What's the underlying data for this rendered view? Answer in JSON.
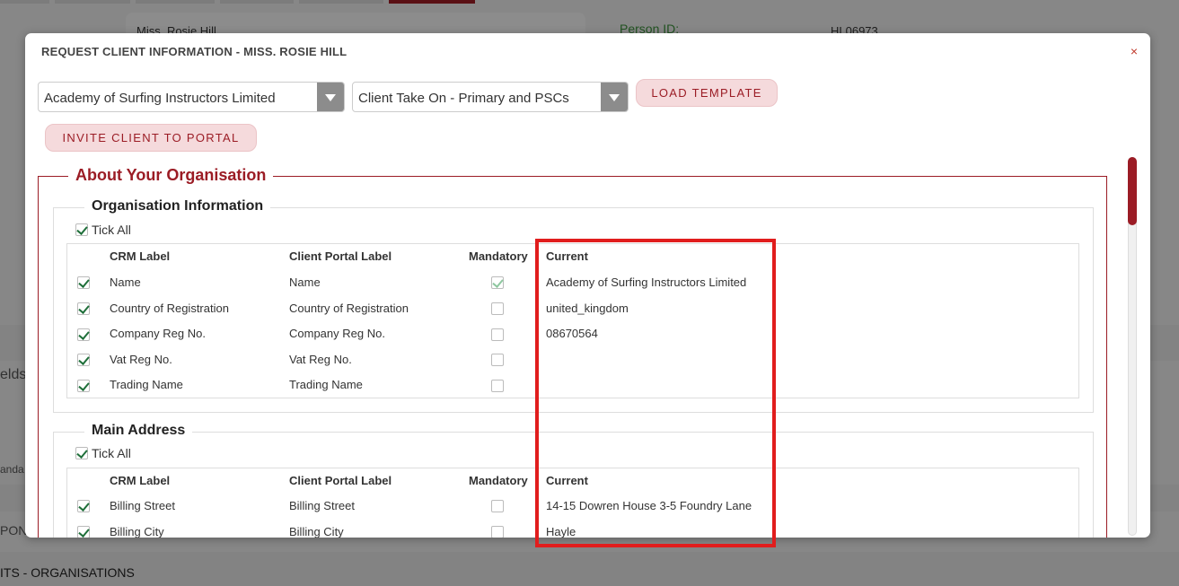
{
  "background": {
    "record_name": "Miss. Rosie Hill",
    "person_id_label": "Person ID:",
    "person_id_value": "HL06973",
    "side_text_1": "elds",
    "side_text_2": "anda",
    "side_text_3": "PON",
    "bottom_text": "ITS - ORGANISATIONS"
  },
  "modal": {
    "title": "REQUEST CLIENT INFORMATION - MISS. ROSIE HILL",
    "close_glyph": "×",
    "organisation_select": "Academy of Surfing Instructors Limited",
    "template_select": "Client Take On - Primary and PSCs",
    "load_template_label": "LOAD TEMPLATE",
    "invite_label": "INVITE CLIENT TO PORTAL"
  },
  "section": {
    "title": "About Your Organisation",
    "columns": {
      "crm": "CRM Label",
      "portal": "Client Portal Label",
      "mandatory": "Mandatory",
      "current": "Current"
    },
    "groups": [
      {
        "title": "Organisation Information",
        "tick_all": "Tick All",
        "rows": [
          {
            "crm": "Name",
            "portal": "Name",
            "current": "Academy of Surfing Instructors Limited"
          },
          {
            "crm": "Country of Registration",
            "portal": "Country of Registration",
            "current": "united_kingdom"
          },
          {
            "crm": "Company Reg No.",
            "portal": "Company Reg No.",
            "current": "08670564"
          },
          {
            "crm": "Vat Reg No.",
            "portal": "Vat Reg No.",
            "current": ""
          },
          {
            "crm": "Trading Name",
            "portal": "Trading Name",
            "current": ""
          }
        ]
      },
      {
        "title": "Main Address",
        "tick_all": "Tick All",
        "rows": [
          {
            "crm": "Billing Street",
            "portal": "Billing Street",
            "current": "14-15 Dowren House 3-5 Foundry Lane"
          },
          {
            "crm": "Billing City",
            "portal": "Billing City",
            "current": "Hayle"
          }
        ]
      }
    ]
  },
  "colors": {
    "brand": "#9b1c25",
    "highlight": "#e11d1d",
    "check": "#1f6f3a"
  }
}
